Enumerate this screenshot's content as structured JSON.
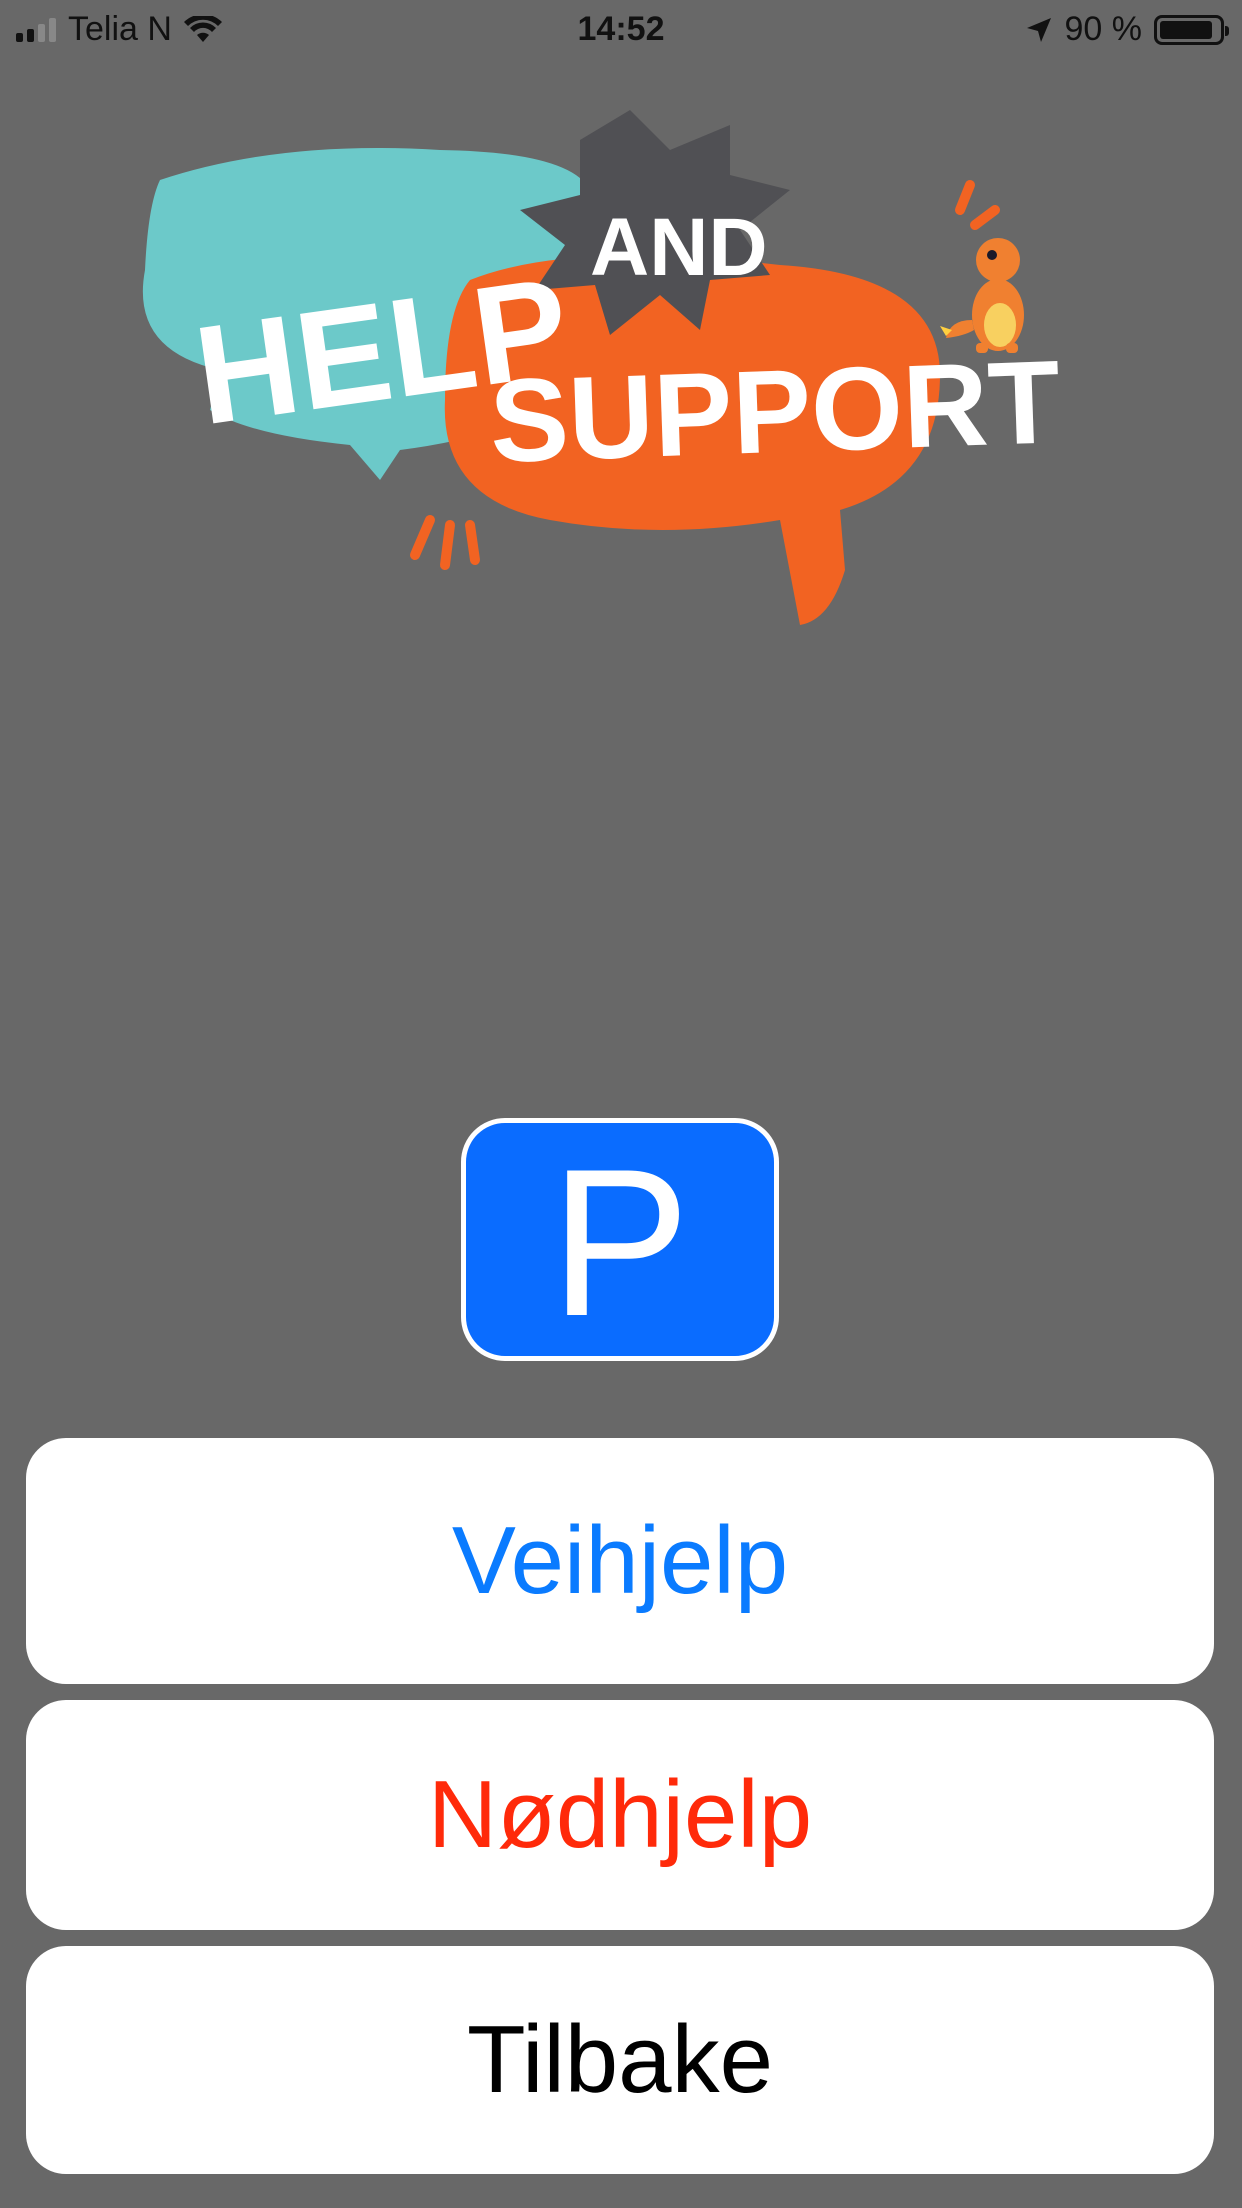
{
  "status_bar": {
    "carrier": "Telia N",
    "time": "14:52",
    "battery": "90 %",
    "battery_level": 0.9,
    "icons": [
      "signal-icon",
      "wifi-icon",
      "location-arrow-icon",
      "battery-icon"
    ]
  },
  "logo": {
    "help": "HELP",
    "and": "AND",
    "support": "SUPPORT",
    "colors": {
      "teal": "#6cc9c9",
      "orange": "#f26322",
      "dark_gray": "#505054",
      "white": "#ffffff"
    },
    "mascot": "charmander-icon"
  },
  "parking_sign": {
    "letter": "P",
    "color": "#0a6cff"
  },
  "buttons": {
    "veihjelp": {
      "label": "Veihjelp",
      "color": "#0a7bff"
    },
    "nodhjelp": {
      "label": "Nødhjelp",
      "color": "#ff2a0a"
    },
    "tilbake": {
      "label": "Tilbake",
      "color": "#000000"
    }
  }
}
